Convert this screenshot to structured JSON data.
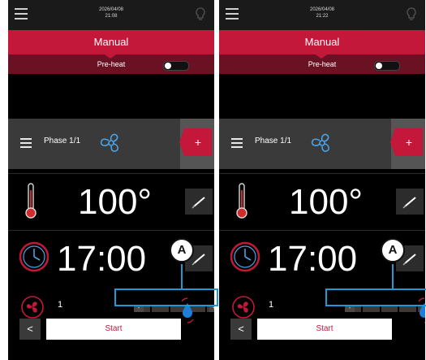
{
  "screens": [
    {
      "topbar": {
        "date": "2026/04/08",
        "time": "21:08"
      },
      "mode_title": "Manual",
      "preheat_label": "Pre-heat",
      "phase_label": "Phase 1/1",
      "add_label": "+",
      "temperature": "100°",
      "timer": "17:00",
      "fan_speed": "1",
      "slider_minus": "-",
      "slider_plus": "+",
      "fan_level": 0.55,
      "back_label": "<",
      "start_label": "Start",
      "annotation": "A"
    },
    {
      "topbar": {
        "date": "2026/04/08",
        "time": "21:22"
      },
      "mode_title": "Manual",
      "preheat_label": "Pre-heat",
      "phase_label": "Phase 1/1",
      "add_label": "+",
      "temperature": "100°",
      "timer": "17:00",
      "fan_speed": "1",
      "slider_minus": "-",
      "slider_plus": "+",
      "fan_level": 1.0,
      "back_label": "<",
      "start_label": "Start",
      "annotation": "A"
    }
  ],
  "colors": {
    "accent": "#c4183a",
    "accent_dark": "#6b1124",
    "highlight": "#1e9ad6",
    "icon_blue": "#4aa3e8"
  },
  "icons": [
    "menu-icon",
    "lightbulb-icon",
    "list-icon",
    "fan-icon",
    "thermometer-icon",
    "clock-icon",
    "edit-icon",
    "fan-speed-icon",
    "water-drop-icon",
    "chevron-left-icon"
  ]
}
